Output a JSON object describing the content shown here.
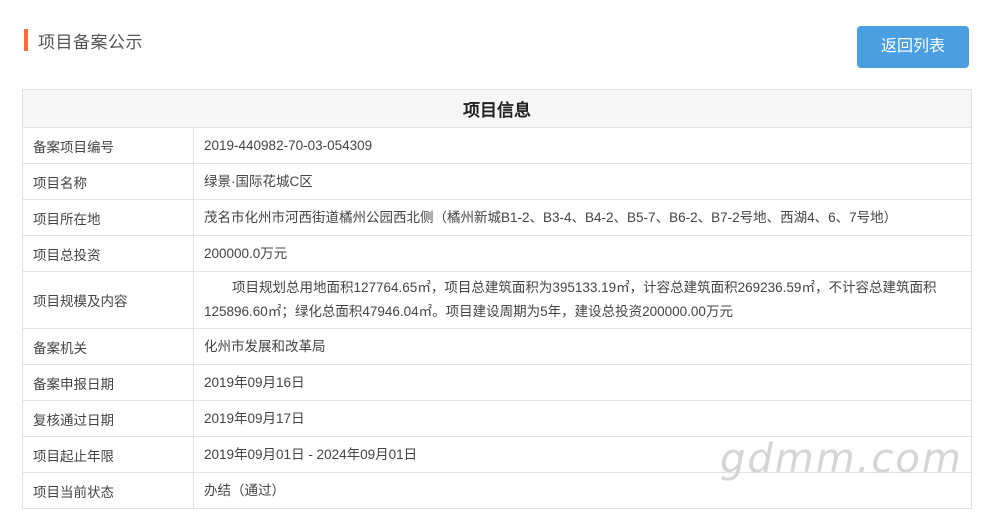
{
  "header": {
    "title": "项目备案公示"
  },
  "actions": {
    "back_label": "返回列表"
  },
  "table": {
    "caption": "项目信息",
    "rows": [
      {
        "label": "备案项目编号",
        "value": "2019-440982-70-03-054309"
      },
      {
        "label": "项目名称",
        "value": "绿景·国际花城C区"
      },
      {
        "label": "项目所在地",
        "value": "茂名市化州市河西街道橘州公园西北侧（橘州新城B1-2、B3-4、B4-2、B5-7、B6-2、B7-2号地、西湖4、6、7号地）"
      },
      {
        "label": "项目总投资",
        "value": "200000.0万元"
      },
      {
        "label": "项目规模及内容",
        "value": "项目规划总用地面积127764.65㎡，项目总建筑面积为395133.19㎡，计容总建筑面积269236.59㎡，不计容总建筑面积125896.60㎡；绿化总面积47946.04㎡。项目建设周期为5年，建设总投资200000.00万元"
      },
      {
        "label": "备案机关",
        "value": "化州市发展和改革局"
      },
      {
        "label": "备案申报日期",
        "value": "2019年09月16日"
      },
      {
        "label": "复核通过日期",
        "value": "2019年09月17日"
      },
      {
        "label": "项目起止年限",
        "value": "2019年09月01日 - 2024年09月01日"
      },
      {
        "label": "项目当前状态",
        "value": "办结（通过）"
      }
    ]
  },
  "watermark": {
    "text": "gdmm.com"
  },
  "colors": {
    "accent_bar": "#ff6a3d",
    "button": "#4a9fe0"
  }
}
